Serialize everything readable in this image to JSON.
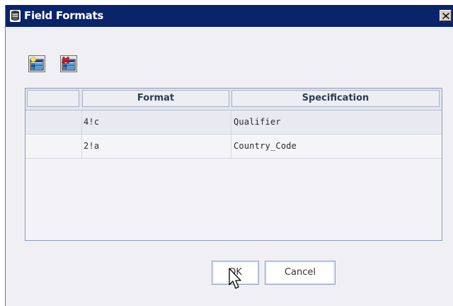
{
  "window": {
    "title": "Field Formats",
    "close_glyph": "✕"
  },
  "toolbar": {
    "add_row_icon": "add-row-icon",
    "delete_row_icon": "delete-row-icon"
  },
  "table": {
    "columns": [
      "",
      "Format",
      "Specification"
    ],
    "rows": [
      {
        "format": "4!c",
        "specification": "Qualifier"
      },
      {
        "format": "2!a",
        "specification": "Country_Code"
      }
    ]
  },
  "buttons": {
    "ok": "OK",
    "cancel": "Cancel"
  },
  "colors": {
    "titlebar": "#0a246a",
    "dialog_bg": "#f0f0f4",
    "header_text": "#2b3d57",
    "button_border": "#8d9dbb"
  }
}
